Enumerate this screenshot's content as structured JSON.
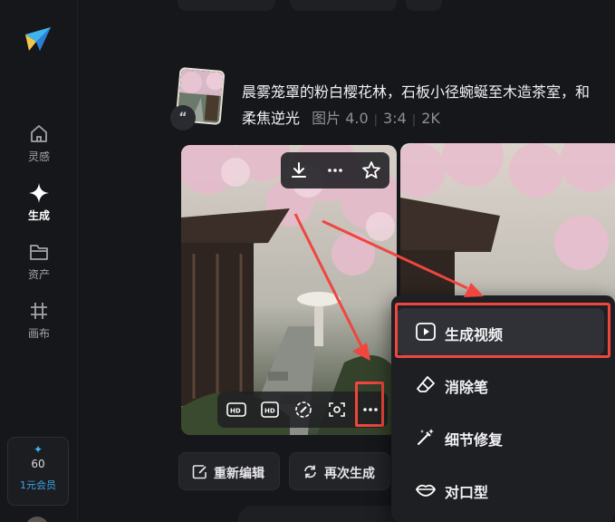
{
  "sidebar": {
    "items": [
      {
        "label": "灵感",
        "icon": "home-icon"
      },
      {
        "label": "生成",
        "icon": "sparkle-icon"
      },
      {
        "label": "资产",
        "icon": "folder-icon"
      },
      {
        "label": "画布",
        "icon": "canvas-icon"
      }
    ],
    "member": {
      "count": "60",
      "label": "1元会员"
    }
  },
  "prompt": {
    "text": "晨雾笼罩的粉白樱花林，石板小径蜿蜒至木造茶室，和",
    "tail": "柔焦逆光",
    "model": "图片 4.0",
    "ratio": "3:4",
    "resolution": "2K"
  },
  "actions": {
    "reedit": "重新编辑",
    "regenerate": "再次生成"
  },
  "context_menu": {
    "items": [
      {
        "label": "生成视频",
        "icon": "play-icon"
      },
      {
        "label": "消除笔",
        "icon": "eraser-icon"
      },
      {
        "label": "细节修复",
        "icon": "magic-wand-icon"
      },
      {
        "label": "对口型",
        "icon": "lips-icon"
      }
    ]
  },
  "colors": {
    "accent": "#3aa6e6",
    "annotation": "#f0463e",
    "background": "#16171b"
  }
}
